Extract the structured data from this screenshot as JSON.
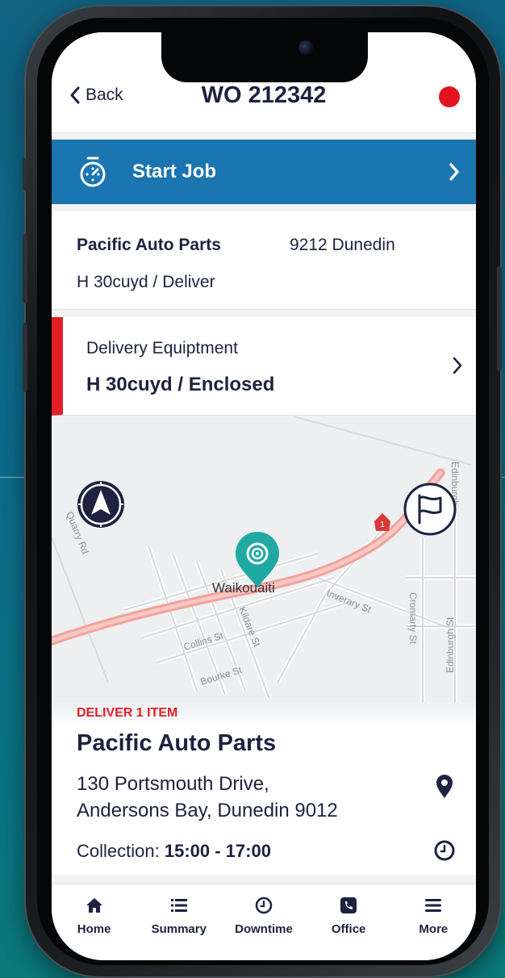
{
  "header": {
    "back_label": "Back",
    "title": "WO 212342"
  },
  "start_job": {
    "label": "Start Job"
  },
  "job_info": {
    "company": "Pacific Auto Parts",
    "location": "9212 Dunedin",
    "equipment": "H 30cuyd / Deliver"
  },
  "equipment_row": {
    "label": "Delivery Equiptment",
    "value": "H 30cuyd / Enclosed"
  },
  "map": {
    "town_label": "Waikouaiti",
    "streets": [
      "Quarry Rd",
      "Kildare St",
      "Collins St",
      "Bourke St",
      "Inverary St",
      "Cromarty St",
      "Edinburgh St",
      "Edinburgh"
    ],
    "route_marker": "1"
  },
  "stop_card": {
    "task": "DELIVER 1 ITEM",
    "name": "Pacific Auto Parts",
    "address_line1": "130 Portsmouth Drive,",
    "address_line2": "Andersons Bay, Dunedin 9012",
    "collection_label": "Collection:",
    "collection_time": "15:00 - 17:00"
  },
  "tabs": [
    {
      "label": "Home",
      "icon": "home-icon"
    },
    {
      "label": "Summary",
      "icon": "list-icon"
    },
    {
      "label": "Downtime",
      "icon": "clock-icon"
    },
    {
      "label": "Office",
      "icon": "phone-icon"
    },
    {
      "label": "More",
      "icon": "menu-icon"
    }
  ],
  "colors": {
    "brand_blue": "#1a75b0",
    "navy": "#1c2240",
    "alert_red": "#e21f26",
    "pin_teal": "#1fa9a2"
  }
}
